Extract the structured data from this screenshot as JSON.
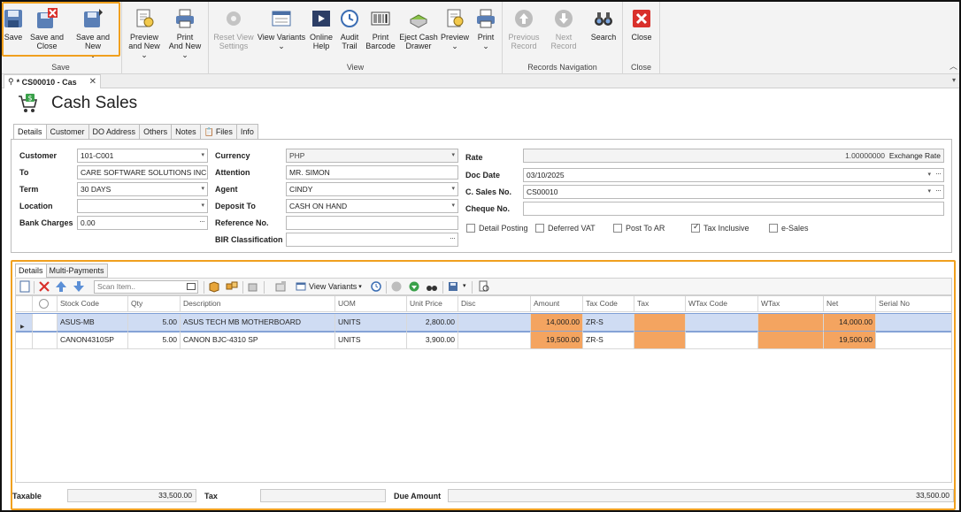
{
  "ribbon": {
    "save_group": {
      "label": "Save",
      "save": "Save",
      "save_close": [
        "Save and",
        "Close"
      ],
      "save_new": [
        "Save and New",
        "⌄"
      ]
    },
    "new_group": {
      "preview_new": [
        "Preview",
        "and New ⌄"
      ],
      "print_new": [
        "Print",
        "And New ⌄"
      ]
    },
    "view_group": {
      "label": "View",
      "reset_view": [
        "Reset View",
        "Settings"
      ],
      "view_variants": [
        "View Variants",
        "⌄"
      ],
      "online_help": [
        "Online",
        "Help"
      ],
      "audit_trail": [
        "Audit",
        "Trail"
      ],
      "print_barcode": [
        "Print",
        "Barcode"
      ],
      "eject_cash": [
        "Eject Cash",
        "Drawer"
      ],
      "preview": [
        "Preview",
        "⌄"
      ],
      "print": [
        "Print",
        "⌄"
      ]
    },
    "nav_group": {
      "label": "Records Navigation",
      "previous": [
        "Previous",
        "Record"
      ],
      "next": "Next Record",
      "search": "Search"
    },
    "close_group": {
      "label": "Close",
      "close": "Close"
    }
  },
  "doc_tab": {
    "title": "* CS00010 - Cas",
    "close": "✕"
  },
  "page_title": "Cash Sales",
  "form_tabs": [
    "Details",
    "Customer",
    "DO Address",
    "Others",
    "Notes",
    "Files",
    "Info"
  ],
  "form": {
    "customer": {
      "label": "Customer",
      "value": "101-C001"
    },
    "to": {
      "label": "To",
      "value": "CARE SOFTWARE SOLUTIONS INC."
    },
    "term": {
      "label": "Term",
      "value": "30 DAYS"
    },
    "location": {
      "label": "Location",
      "value": ""
    },
    "bank_charges": {
      "label": "Bank Charges",
      "value": "0.00"
    },
    "currency": {
      "label": "Currency",
      "value": "PHP"
    },
    "attention": {
      "label": "Attention",
      "value": "MR. SIMON"
    },
    "agent": {
      "label": "Agent",
      "value": "CINDY"
    },
    "deposit_to": {
      "label": "Deposit To",
      "value": "CASH ON HAND"
    },
    "reference_no": {
      "label": "Reference No.",
      "value": ""
    },
    "bir_classification": {
      "label": "BIR Classification",
      "value": ""
    },
    "rate": {
      "label": "Rate",
      "value": "1.00000000",
      "unit": "Exchange Rate"
    },
    "doc_date": {
      "label": "Doc Date",
      "value": "03/10/2025"
    },
    "c_sales_no": {
      "label": "C. Sales No.",
      "value": "CS00010"
    },
    "cheque_no": {
      "label": "Cheque No.",
      "value": ""
    },
    "checks": {
      "detail_posting": {
        "label": "Detail Posting",
        "checked": false
      },
      "deferred_vat": {
        "label": "Deferred VAT",
        "checked": false
      },
      "post_to_ar": {
        "label": "Post To AR",
        "checked": false
      },
      "tax_inclusive": {
        "label": "Tax Inclusive",
        "checked": true
      },
      "e_sales": {
        "label": "e-Sales",
        "checked": false
      }
    }
  },
  "lower_tabs": [
    "Details",
    "Multi-Payments"
  ],
  "toolbar": {
    "scan_placeholder": "Scan Item..",
    "view_variants": "View Variants"
  },
  "grid": {
    "columns": [
      "Stock Code",
      "Qty",
      "Description",
      "UOM",
      "Unit Price",
      "Disc",
      "Amount",
      "Tax Code",
      "Tax",
      "WTax Code",
      "WTax",
      "Net",
      "Serial No"
    ],
    "rows": [
      [
        "ASUS-MB",
        "5.00",
        "ASUS TECH MB MOTHERBOARD",
        "UNITS",
        "2,800.00",
        "",
        "14,000.00",
        "ZR-S",
        "",
        "",
        "",
        "14,000.00",
        ""
      ],
      [
        "CANON4310SP",
        "5.00",
        "CANON BJC-4310 SP",
        "UNITS",
        "3,900.00",
        "",
        "19,500.00",
        "ZR-S",
        "",
        "",
        "",
        "19,500.00",
        ""
      ]
    ]
  },
  "totals": {
    "taxable_label": "Taxable",
    "taxable": "33,500.00",
    "tax_label": "Tax",
    "tax": "",
    "due_label": "Due Amount",
    "due": "33,500.00"
  },
  "colors": {
    "highlight": "#f0a01e",
    "orange_cell": "#f4a460",
    "selected_row": "#cfdcf3"
  }
}
